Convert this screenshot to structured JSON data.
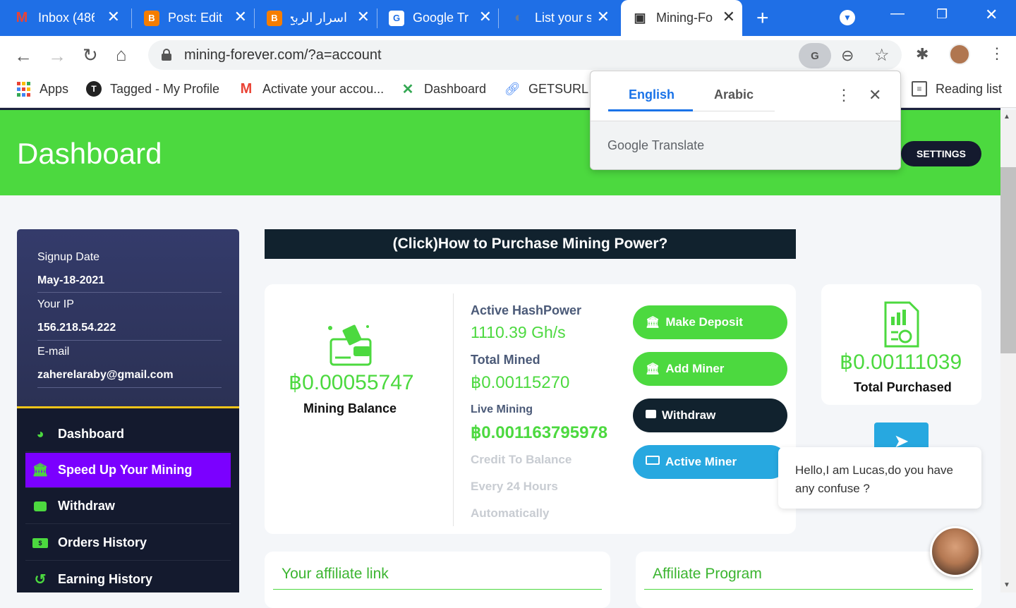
{
  "browser": {
    "tabs": [
      {
        "title": "Inbox (486",
        "icon": "gmail-icon",
        "fav": "M"
      },
      {
        "title": "Post: Edit",
        "icon": "blogger-icon",
        "fav": "B"
      },
      {
        "title": "اسرار الربح",
        "icon": "blogger-icon",
        "fav": "B"
      },
      {
        "title": "Google Tr",
        "icon": "google-translate-icon",
        "fav": "G"
      },
      {
        "title": "List your s",
        "icon": "globe-icon",
        "fav": "◐"
      },
      {
        "title": "Mining-Fo",
        "icon": "mining-icon",
        "fav": "▣"
      }
    ],
    "url": "mining-forever.com/?a=account",
    "bookmarks": [
      {
        "label": "Apps"
      },
      {
        "label": "Tagged - My Profile"
      },
      {
        "label": "Activate your accou..."
      },
      {
        "label": "Dashboard"
      },
      {
        "label": "GETSURL -"
      }
    ],
    "reading_list": "Reading list"
  },
  "translate_popup": {
    "lang_from": "English",
    "lang_to": "Arabic",
    "brand_google": "Google",
    "brand_translate": "Translate"
  },
  "header": {
    "title": "Dashboard",
    "settings_label": "SETTINGS"
  },
  "account": {
    "signup_label": "Signup Date",
    "signup_value": "May-18-2021",
    "ip_label": "Your IP",
    "ip_value": "156.218.54.222",
    "email_label": "E-mail",
    "email_value": "zaherelaraby@gmail.com"
  },
  "nav": [
    {
      "label": "Dashboard",
      "icon": "gauge-icon"
    },
    {
      "label": "Speed Up Your Mining",
      "icon": "bank-icon"
    },
    {
      "label": "Withdraw",
      "icon": "wallet-icon"
    },
    {
      "label": "Orders History",
      "icon": "money-icon"
    },
    {
      "label": "Earning History",
      "icon": "history-icon"
    }
  ],
  "main": {
    "howto_label": "(Click)How to Purchase Mining Power?",
    "mining_balance_value": "฿0.00055747",
    "mining_balance_label": "Mining Balance",
    "active_hashpower_label": "Active HashPower",
    "active_hashpower_value": "1110.39 Gh/s",
    "total_mined_label": "Total Mined",
    "total_mined_value": "฿0.00115270",
    "live_mining_label": "Live Mining",
    "live_mining_value": "฿0.001163795978",
    "credit_line1": "Credit To Balance",
    "credit_line2": "Every 24 Hours",
    "credit_line3": "Automatically",
    "buttons": {
      "deposit": "Make Deposit",
      "add_miner": "Add Miner",
      "withdraw": "Withdraw",
      "active_miner": "Active Miner"
    },
    "total_purchased_value": "฿0.00111039",
    "total_purchased_label": "Total Purchased",
    "affiliate_link_title": "Your affiliate link",
    "affiliate_program_title": "Affiliate Program"
  },
  "chat": {
    "message": "Hello,I am Lucas,do you have any confuse ?"
  },
  "colors": {
    "accent_green": "#4cd93f",
    "navy": "#141a2e",
    "purple": "#7b00ff",
    "tab_blue": "#1f6fe6"
  }
}
